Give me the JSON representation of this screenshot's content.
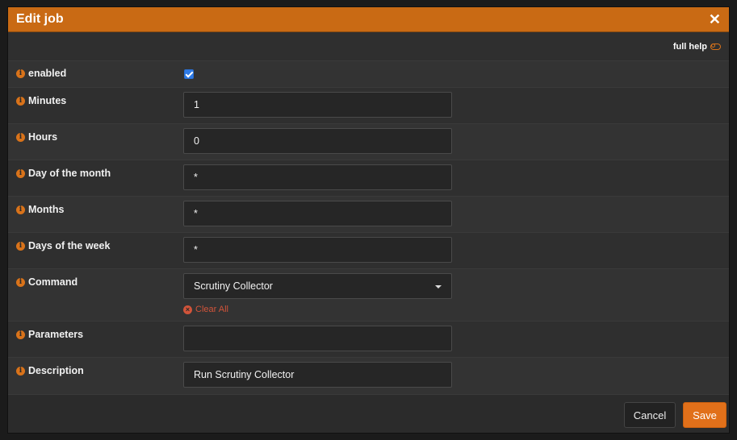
{
  "dialog": {
    "title": "Edit job",
    "close_glyph": "✕"
  },
  "help": {
    "label": "full help"
  },
  "fields": {
    "enabled": {
      "label": "enabled",
      "checked": true
    },
    "minutes": {
      "label": "Minutes",
      "value": "1"
    },
    "hours": {
      "label": "Hours",
      "value": "0"
    },
    "day_of_month": {
      "label": "Day of the month",
      "value": "*"
    },
    "months": {
      "label": "Months",
      "value": "*"
    },
    "days_of_week": {
      "label": "Days of the week",
      "value": "*"
    },
    "command": {
      "label": "Command",
      "value": "Scrutiny Collector",
      "clear_label": "Clear All"
    },
    "parameters": {
      "label": "Parameters",
      "value": ""
    },
    "description": {
      "label": "Description",
      "value": "Run Scrutiny Collector"
    }
  },
  "footer": {
    "cancel_label": "Cancel",
    "save_label": "Save"
  },
  "icons": {
    "info": "info-icon",
    "close": "close-icon",
    "clear": "clear-icon",
    "toggle": "toggle-icon"
  },
  "colors": {
    "accent": "#c96a14",
    "save": "#e1701a",
    "checkbox": "#2e7be8",
    "clear": "#d1543a"
  }
}
